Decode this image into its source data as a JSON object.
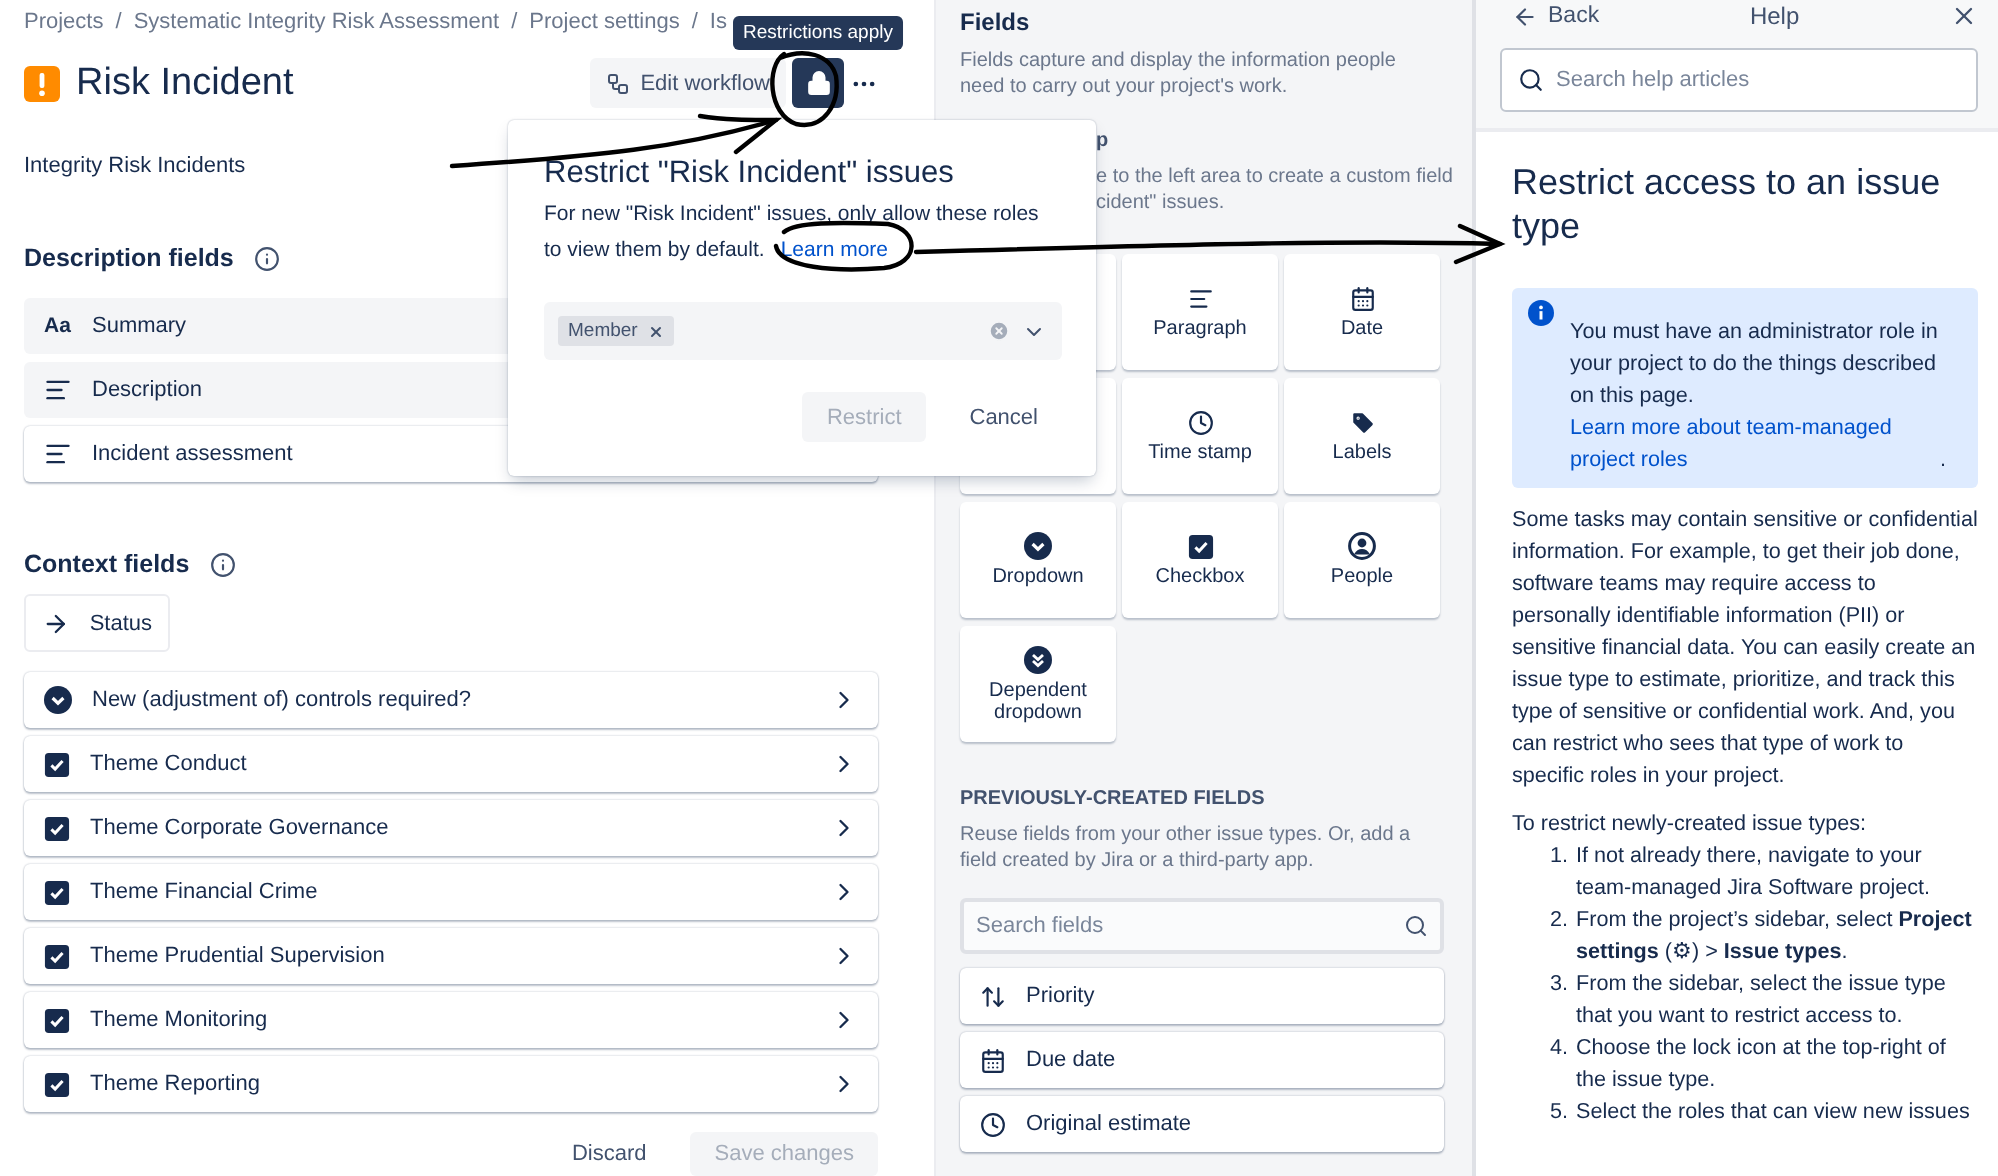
{
  "breadcrumbs": [
    "Projects",
    "Systematic Integrity Risk Assessment",
    "Project settings",
    "Is"
  ],
  "breadcrumb_separator": "/",
  "tooltip": "Restrictions apply",
  "issue_type": {
    "title": "Risk Incident",
    "description": "Integrity Risk Incidents"
  },
  "toolbar": {
    "edit_workflow": "Edit workflow",
    "restricted": true
  },
  "description_fields": {
    "title": "Description fields",
    "fields": [
      {
        "label": "Summary",
        "kind": "text",
        "glyph": "Aa"
      },
      {
        "label": "Description",
        "kind": "paragraph"
      },
      {
        "label": "Incident assessment",
        "kind": "paragraph"
      }
    ]
  },
  "context_fields": {
    "title": "Context fields",
    "status": "Status",
    "fields": [
      {
        "label": "New (adjustment of) controls required?",
        "kind": "dropdown"
      },
      {
        "label": "Theme Conduct",
        "kind": "checkbox"
      },
      {
        "label": "Theme Corporate Governance",
        "kind": "checkbox"
      },
      {
        "label": "Theme Financial Crime",
        "kind": "checkbox"
      },
      {
        "label": "Theme Prudential Supervision",
        "kind": "checkbox"
      },
      {
        "label": "Theme Monitoring",
        "kind": "checkbox"
      },
      {
        "label": "Theme Reporting",
        "kind": "checkbox"
      }
    ]
  },
  "actions": {
    "discard": "Discard",
    "save": "Save changes",
    "save_disabled": true
  },
  "popover": {
    "title": "Restrict \"Risk Incident\" issues",
    "text_lines": [
      "For new \"Risk Incident\" issues, only allow these roles",
      "to view them by default."
    ],
    "link": "Learn more",
    "roles": [
      "Member"
    ],
    "restrict": "Restrict",
    "restrict_disabled": true,
    "cancel": "Cancel"
  },
  "fields_panel": {
    "title": "Fields",
    "description": "Fields capture and display the information people need to carry out your project's work.",
    "create_heading_visible": "p",
    "create_lines_visible": [
      "e to the left area to create a custom field",
      "cident\" issues."
    ],
    "field_types": [
      {
        "kind": "covered"
      },
      {
        "kind": "paragraph",
        "label": "Paragraph"
      },
      {
        "kind": "date",
        "label": "Date"
      },
      {
        "kind": "covered"
      },
      {
        "kind": "time",
        "label": "Time stamp"
      },
      {
        "kind": "labels",
        "label": "Labels"
      },
      {
        "kind": "dropdown",
        "label": "Dropdown"
      },
      {
        "kind": "checkbox",
        "label": "Checkbox"
      },
      {
        "kind": "people",
        "label": "People"
      },
      {
        "kind": "dependent",
        "label": "Dependent dropdown"
      }
    ],
    "previous": {
      "heading": "PREVIOUSLY-CREATED FIELDS",
      "description": "Reuse fields from your other issue types. Or, add a field created by Jira or a third-party app.",
      "search_placeholder": "Search fields",
      "fields": [
        {
          "label": "Priority",
          "kind": "priority"
        },
        {
          "label": "Due date",
          "kind": "date"
        },
        {
          "label": "Original estimate",
          "kind": "time"
        }
      ]
    }
  },
  "help": {
    "back": "Back",
    "title": "Help",
    "search_placeholder": "Search help articles",
    "article_title": "Restrict access to an issue type",
    "note": {
      "text": "You must have an administrator role in your project to do the things described on this page. ",
      "link": "Learn more about team-managed project roles",
      "after": "."
    },
    "paragraph": "Some tasks may contain sensitive or confidential information. For example, to get their job done, software teams may require access to personally identifiable information (PII) or sensitive financial data. You can easily create an issue type to estimate, prioritize, and track this type of sensitive or confidential work. And, you can restrict who sees that type of work to specific roles in your project.",
    "steps_intro": "To restrict newly-created issue types:",
    "steps": [
      {
        "number": "1.",
        "kind": "plain",
        "text": "If not already there, navigate to your team-managed Jira Software project."
      },
      {
        "number": "2.",
        "kind": "plain",
        "text": "From the project’s sidebar, select **Project settings** (⚙) > **Issue types**."
      },
      {
        "number": "3.",
        "kind": "plain",
        "text": "From the sidebar, select the issue type that you want to restrict access to."
      },
      {
        "number": "4.",
        "kind": "plain",
        "text": "Choose the lock icon at the top-right of the issue type."
      },
      {
        "number": "5.",
        "kind": "plain",
        "text": "Select the roles that can view new issues"
      }
    ]
  }
}
